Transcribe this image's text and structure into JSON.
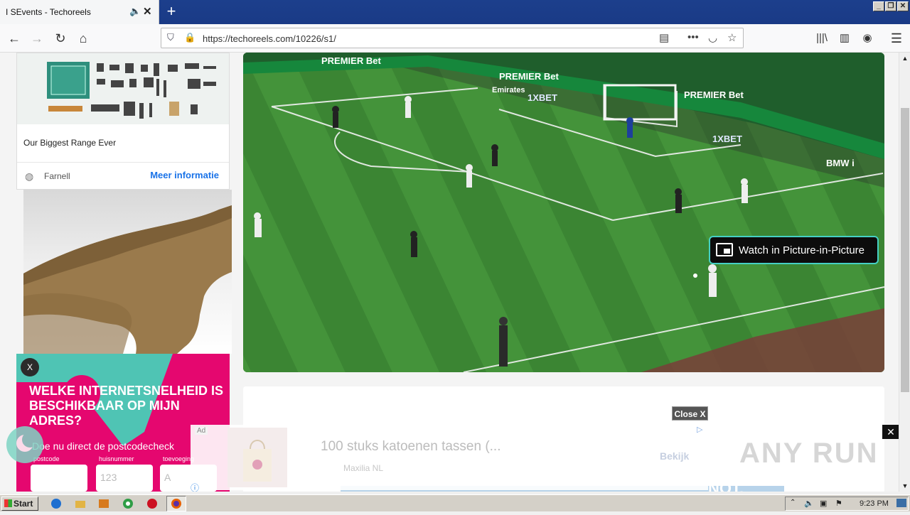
{
  "browser": {
    "tab_title": "I SEvents - Techoreels",
    "tab_mute_icon": "speaker-icon",
    "tab_close_label": "✕",
    "new_tab_label": "+",
    "url": "https://techoreels.com/10226/s1/",
    "window_buttons": [
      "_",
      "❐",
      "✕"
    ]
  },
  "sidebar_ad": {
    "caption": "Our Biggest Range Ever",
    "advertiser": "Farnell",
    "cta": "Meer informatie"
  },
  "pink_ad": {
    "close_label": "X",
    "headline": "WELKE INTERNETSNELHEID IS BESCHIKBAAR OP MIJN ADRES?",
    "subtext": "Doe nu direct de postcodecheck",
    "fields": [
      {
        "label": "postcode",
        "placeholder": ""
      },
      {
        "label": "huisnummer",
        "placeholder": "123"
      },
      {
        "label": "toevoeging",
        "placeholder": "A"
      }
    ]
  },
  "video": {
    "pip_label": "Watch in Picture-in-Picture",
    "ad_boards": [
      "PREMIER Bet",
      "PREMIER Bet",
      "PREMIER Bet",
      "1XBET",
      "1XBET",
      "Emirates",
      "BMW i"
    ]
  },
  "close_overlay_label": "Close X",
  "bottom_ad": {
    "ad_tag": "Ad",
    "headline": "100 stuks katoenen tassen (...",
    "advertiser": "Maxilia NL",
    "cta": "Bekijk",
    "close_label": "✕",
    "background_text": "WE'RE NOT."
  },
  "watermark": "ANY RUN",
  "taskbar": {
    "start_label": "Start",
    "time": "9:23 PM",
    "apps": [
      {
        "name": "ie-icon",
        "color": "#1e6fd0"
      },
      {
        "name": "folder-icon",
        "color": "#e2b444"
      },
      {
        "name": "media-icon",
        "color": "#d77a1e"
      },
      {
        "name": "chrome-icon",
        "color": "#2f9d46"
      },
      {
        "name": "opera-icon",
        "color": "#cc1122"
      },
      {
        "name": "firefox-icon",
        "color": "#e66000"
      }
    ]
  }
}
